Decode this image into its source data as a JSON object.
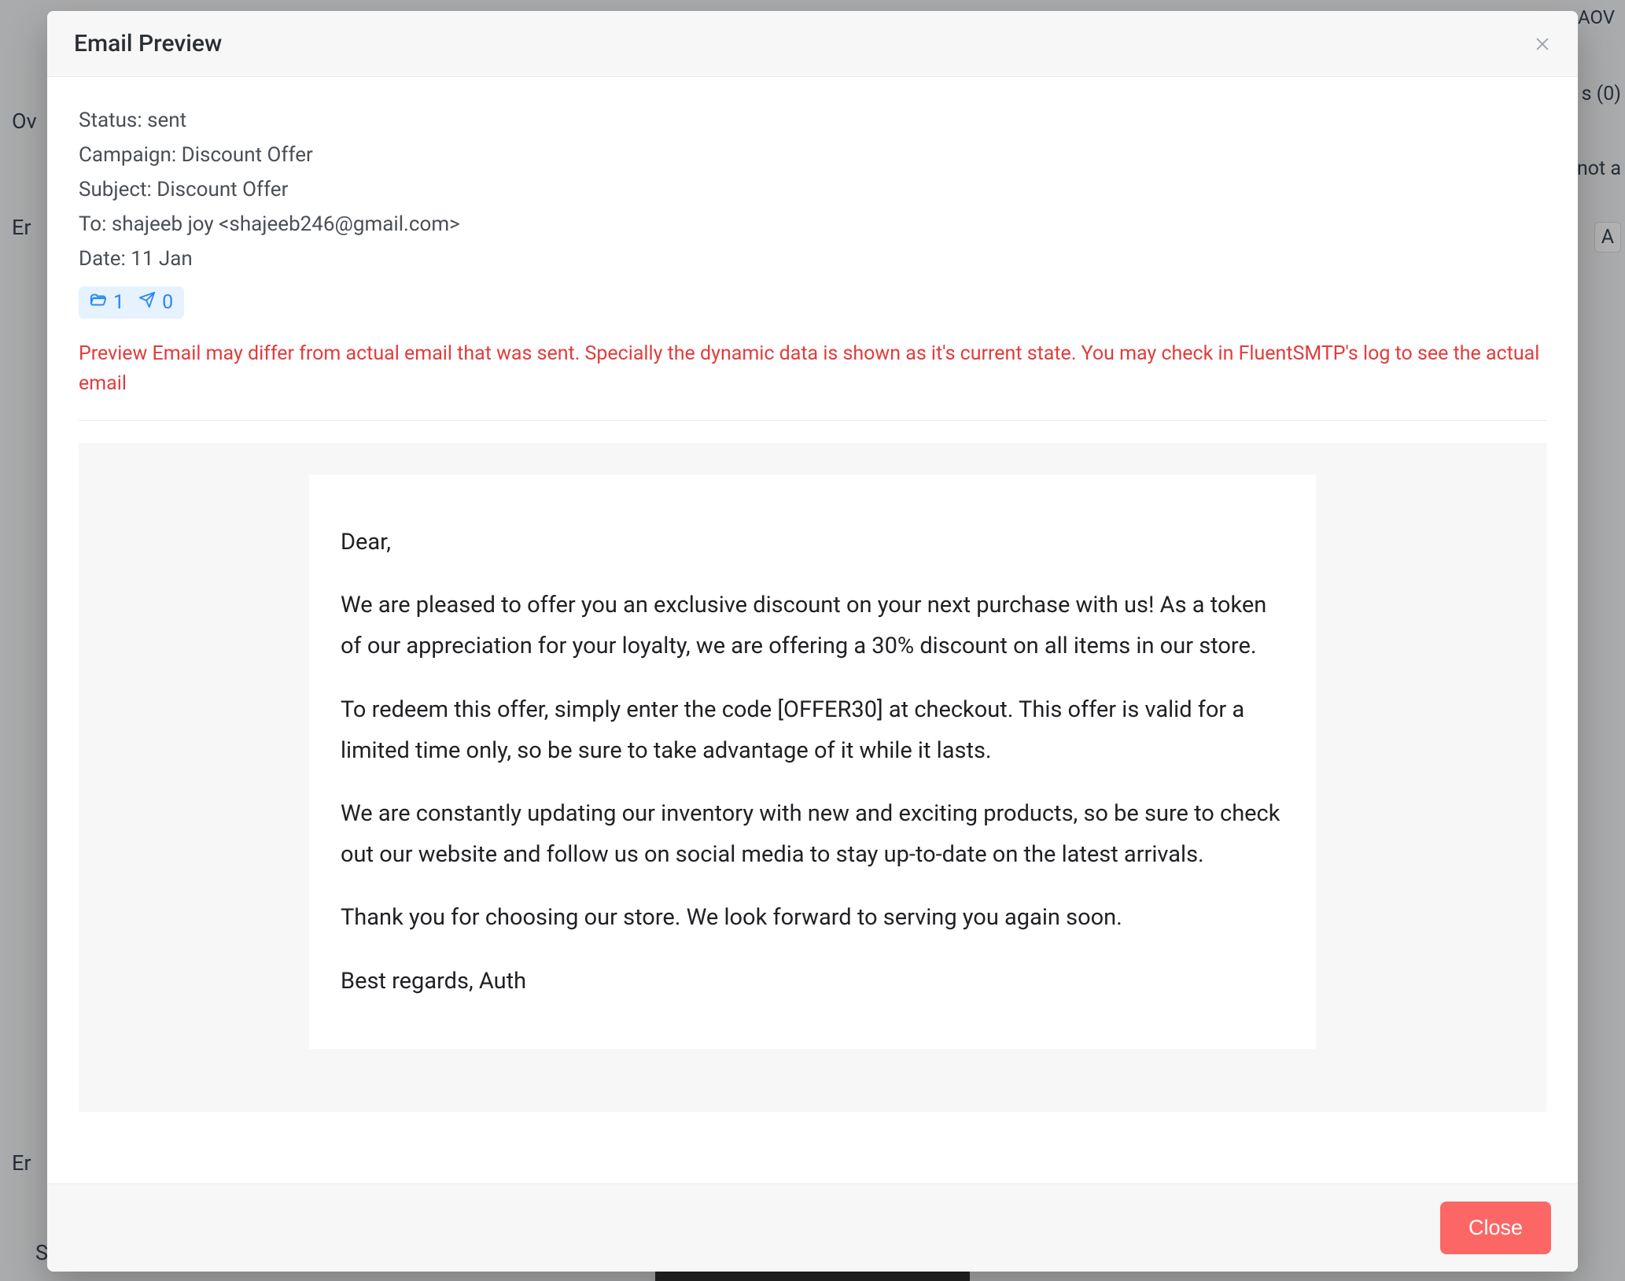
{
  "modal": {
    "title": "Email Preview",
    "close_button_label": "Close"
  },
  "meta": {
    "status_label": "Status:",
    "status_value": "sent",
    "campaign_label": "Campaign:",
    "campaign_value": "Discount Offer",
    "subject_label": "Subject:",
    "subject_value": "Discount Offer",
    "to_label": "To:",
    "to_value": "shajeeb joy <shajeeb246@gmail.com>",
    "date_label": "Date:",
    "date_value": "11 Jan"
  },
  "stats": {
    "opens": "1",
    "clicks": "0"
  },
  "warning_text": "Preview Email may differ from actual email that was sent. Specially the dynamic data is shown as it's current state. You may check in FluentSMTP's log to see the actual email",
  "email_body": {
    "greeting": "Dear,",
    "p1": "We are pleased to offer you an exclusive discount on your next purchase with us! As a token of our appreciation for your loyalty, we are offering a 30% discount on all items in our store.",
    "p2": "To redeem this offer, simply enter the code [OFFER30] at checkout. This offer is valid for a limited time only, so be sure to take advantage of it while it lasts.",
    "p3": "We are constantly updating our inventory with new and exciting products, so be sure to check out our website and follow us on social media to stay up-to-date on the latest arrivals.",
    "p4": "Thank you for choosing our store. We look forward to serving you again soon.",
    "signoff": "Best regards, Auth"
  },
  "background": {
    "aov": "AOV",
    "ov": "Ov",
    "er": "Er",
    "s0": "s (0)",
    "nota": "not a",
    "a": "A",
    "er2": "Er",
    "sc": "S"
  }
}
